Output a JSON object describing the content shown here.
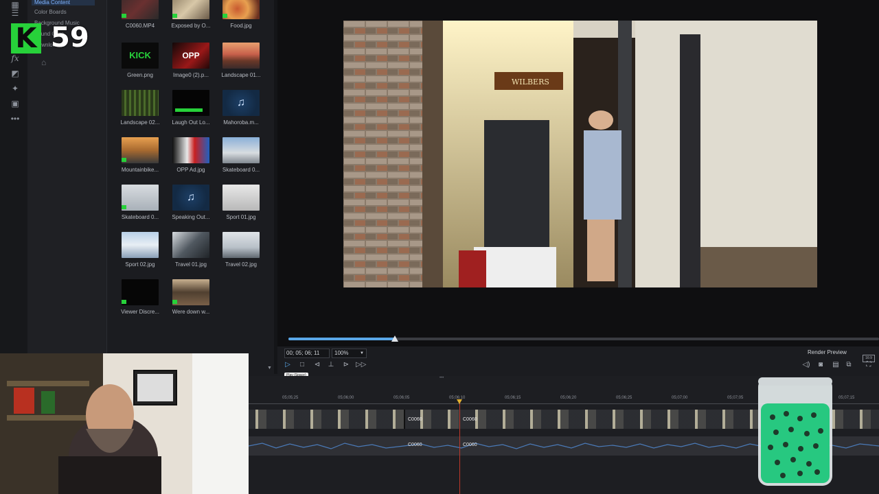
{
  "overlay": {
    "logo_letter": "K",
    "counter": "59"
  },
  "categories": [
    {
      "label": "Media Content",
      "selected": true
    },
    {
      "label": "Color Boards",
      "selected": false
    },
    {
      "label": "Background Music",
      "selected": false
    },
    {
      "label": "Sound Clips",
      "selected": false
    },
    {
      "label": "Downloaded",
      "selected": false
    }
  ],
  "media": [
    {
      "label": "C0060.MP4",
      "kind": "video"
    },
    {
      "label": "Exposed by O...",
      "kind": "image"
    },
    {
      "label": "Food.jpg",
      "kind": "image"
    },
    {
      "label": "Green.png",
      "kind": "image",
      "thumb_text": "KICK"
    },
    {
      "label": "Image0 (2).p...",
      "kind": "image",
      "thumb_text": "OPP"
    },
    {
      "label": "Landscape 01...",
      "kind": "image"
    },
    {
      "label": "Landscape 02...",
      "kind": "image"
    },
    {
      "label": "Laugh Out Lo...",
      "kind": "image"
    },
    {
      "label": "Mahoroba.m...",
      "kind": "audio"
    },
    {
      "label": "Mountainbike...",
      "kind": "image"
    },
    {
      "label": "OPP Ad.jpg",
      "kind": "image"
    },
    {
      "label": "Skateboard 0...",
      "kind": "image"
    },
    {
      "label": "Skateboard 0...",
      "kind": "image"
    },
    {
      "label": "Speaking Out...",
      "kind": "audio"
    },
    {
      "label": "Sport 01.jpg",
      "kind": "image"
    },
    {
      "label": "Sport 02.jpg",
      "kind": "image"
    },
    {
      "label": "Travel 01.jpg",
      "kind": "image"
    },
    {
      "label": "Travel 02.jpg",
      "kind": "image"
    },
    {
      "label": "Viewer Discre...",
      "kind": "image"
    },
    {
      "label": "Were down w...",
      "kind": "image"
    }
  ],
  "preview": {
    "sign_text": "WILBERS",
    "scrub_progress": 0.18
  },
  "controls": {
    "timecode": "00; 05; 06; 11",
    "zoom": "100%",
    "render_preview": "Render Preview",
    "play_tooltip": "Play (Space)",
    "aspect": "16:9"
  },
  "timeline": {
    "ticks": [
      "05;05;25",
      "05;06;00",
      "05;06;05",
      "05;06;10",
      "05;06;15",
      "05;06;20",
      "05;06;25",
      "05;07;00",
      "05;07;05",
      "05;07;15"
    ],
    "clip_label": "C0060"
  },
  "colors": {
    "accent": "#5aa7e8",
    "kick_green": "#27d13a",
    "playhead": "#c0392b",
    "marker": "#e0b030"
  },
  "icons": [
    "fx-icon",
    "transition-icon",
    "particle-icon",
    "title-icon",
    "more-icon",
    "play-icon",
    "stop-icon",
    "prev-frame-icon",
    "next-frame-icon",
    "fast-forward-icon",
    "volume-icon",
    "snapshot-icon",
    "settings-icon",
    "undock-icon"
  ]
}
